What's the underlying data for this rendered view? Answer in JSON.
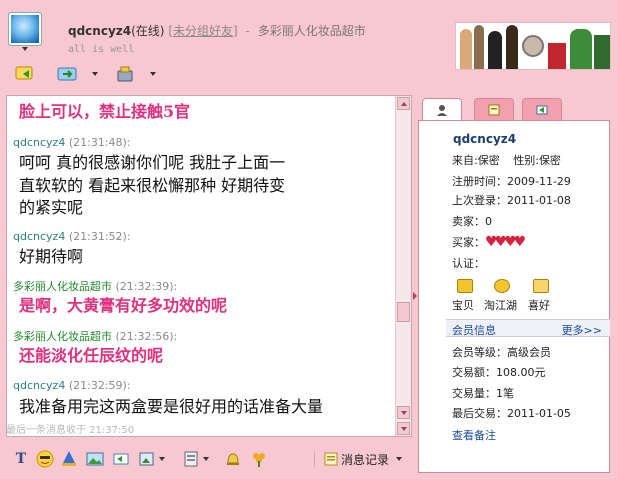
{
  "header": {
    "nickname": "qdcncyz4",
    "status": "(在线)",
    "group": "[未分组好友]",
    "separator": "-",
    "shop_name": "多彩丽人化妆品超市",
    "signature": "all is well"
  },
  "toolbar_icons": [
    "reply-icon",
    "transfer-icon",
    "tools-icon"
  ],
  "chat": {
    "messages": [
      {
        "type": "text-pink",
        "text": "脸上可以，禁止接触5官"
      },
      {
        "type": "header",
        "sender": "qdcncyz4",
        "role": "customer",
        "time": "(21:31:48):"
      },
      {
        "type": "text",
        "text": "呵呵     真的很感谢你们呢     我肚子上面一"
      },
      {
        "type": "text",
        "text": "直软软的     看起来很松懈那种     好期待变"
      },
      {
        "type": "text",
        "text": "的紧实呢"
      },
      {
        "type": "header",
        "sender": "qdcncyz4",
        "role": "customer",
        "time": "(21:31:52):"
      },
      {
        "type": "text",
        "text": "好期待啊"
      },
      {
        "type": "header",
        "sender": "多彩丽人化妆品超市",
        "role": "shop",
        "time": "(21:32:39):"
      },
      {
        "type": "text-pink",
        "text": "是啊，大黄膏有好多功效的呢"
      },
      {
        "type": "header",
        "sender": "多彩丽人化妆品超市",
        "role": "shop",
        "time": "(21:32:56):"
      },
      {
        "type": "text-pink",
        "text": "还能淡化任辰纹的呢"
      },
      {
        "type": "header",
        "sender": "qdcncyz4",
        "role": "customer",
        "time": "(21:32:59):"
      },
      {
        "type": "text",
        "text": "我准备用完这两盒要是很好用的话准备大量"
      }
    ],
    "last_message_note": "最后一条消息收于 21:37:50"
  },
  "bottom_toolbar": {
    "icons": [
      "font-icon",
      "emoji-icon",
      "magic-icon",
      "image-icon",
      "reply-phrase-icon",
      "screenshot-icon",
      "transfer-file-icon",
      "bell-icon",
      "flower-icon"
    ],
    "history_label": "消息记录"
  },
  "tabs": [
    "profile-tab-icon",
    "note-tab-icon",
    "transfer-tab-icon"
  ],
  "profile": {
    "name": "qdcncyz4",
    "from_label": "来自:",
    "from_value": "保密",
    "gender_label": "性别:",
    "gender_value": "保密",
    "reg_label": "注册时间：",
    "reg_value": "2009-11-29",
    "login_label": "上次登录：",
    "login_value": "2011-01-08",
    "seller_label": "卖家：",
    "seller_value": "0",
    "buyer_label": "买家：",
    "verify_label": "认证：",
    "features": [
      "宝贝",
      "淘江湖",
      "喜好"
    ],
    "member_title": "会员信息",
    "member_more": "更多>>",
    "level_label": "会员等级：",
    "level_value": "高级会员",
    "amount_label": "交易额：",
    "amount_value": "108.00元",
    "count_label": "交易量：",
    "count_value": "1笔",
    "last_trade_label": "最后交易：",
    "last_trade_value": "2011-01-05",
    "notes_link": "查看备注"
  }
}
